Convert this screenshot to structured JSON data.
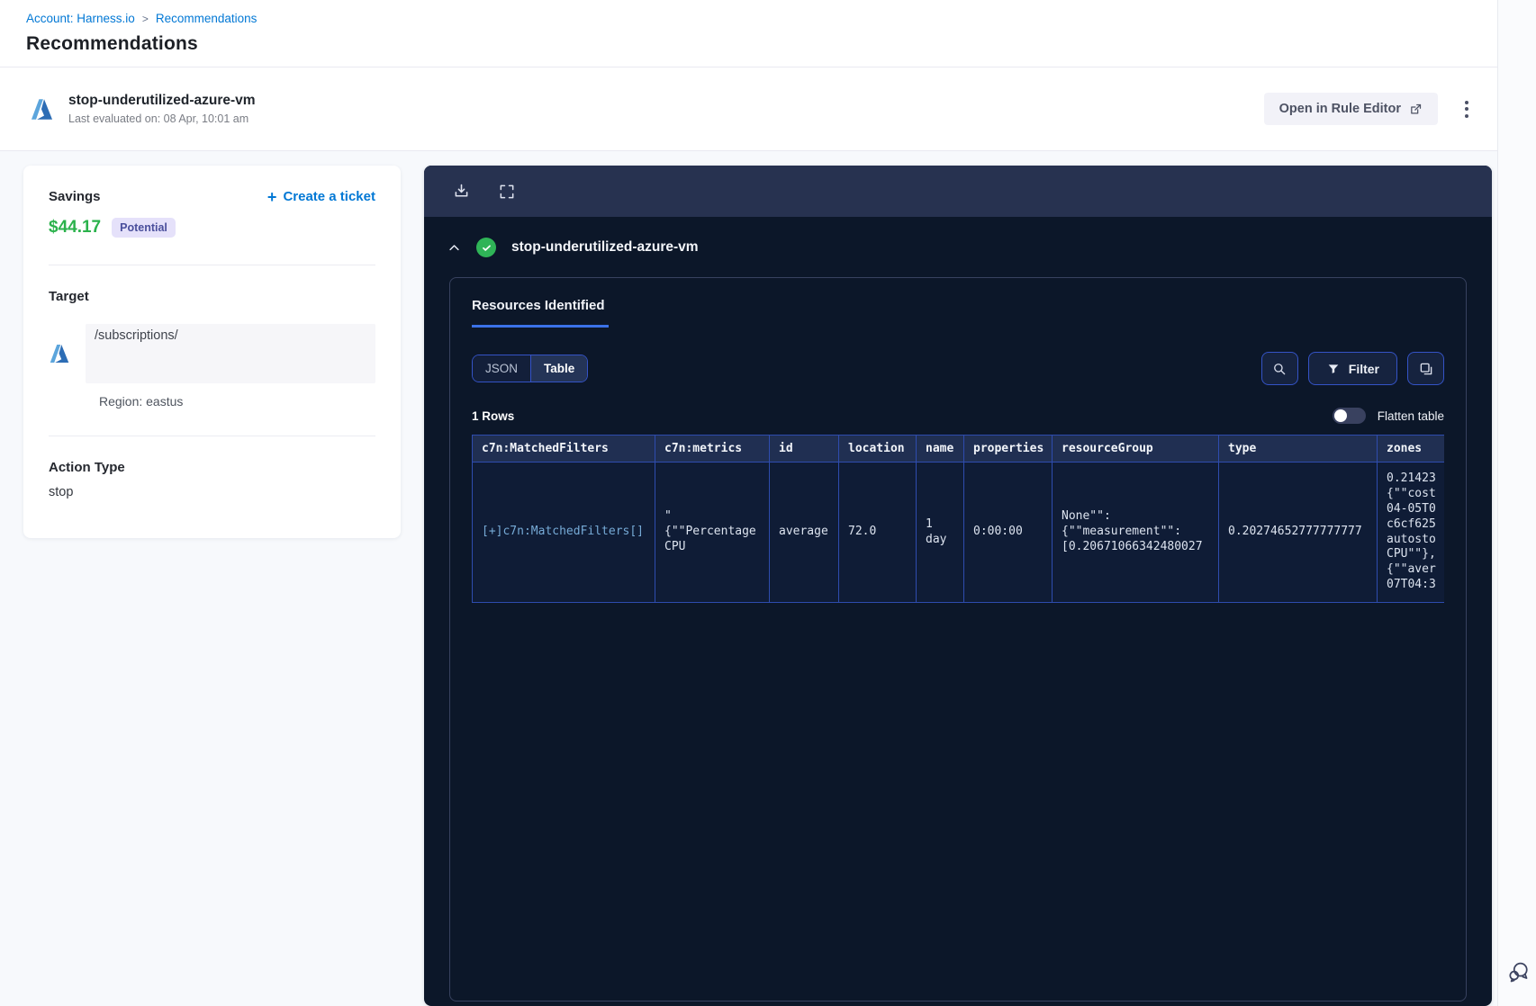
{
  "breadcrumb": {
    "account_link": "Account: Harness.io",
    "separator": ">",
    "current": "Recommendations"
  },
  "page_title": "Recommendations",
  "rec_header": {
    "title": "stop-underutilized-azure-vm",
    "last_evaluated": "Last evaluated on: 08 Apr, 10:01 am",
    "open_rule_editor": "Open in Rule Editor"
  },
  "summary_card": {
    "savings_label": "Savings",
    "savings_amount": "$44.17",
    "savings_badge": "Potential",
    "create_ticket_plus": "+",
    "create_ticket_label": "Create a ticket",
    "target_label": "Target",
    "target_path": "/subscriptions/",
    "target_region": "Region: eastus",
    "action_type_label": "Action Type",
    "action_type_value": "stop"
  },
  "viewer": {
    "resource_title": "stop-underutilized-azure-vm",
    "tab_resources": "Resources Identified",
    "toggle_json": "JSON",
    "toggle_table": "Table",
    "filter_button": "Filter",
    "rows_count": "1 Rows",
    "flatten_label": "Flatten table",
    "table": {
      "columns": [
        "c7n:MatchedFilters",
        "c7n:metrics",
        "id",
        "location",
        "name",
        "properties",
        "resourceGroup",
        "type",
        "zones"
      ],
      "row_values": [
        "[+]c7n:MatchedFilters[]",
        "\"\n{\"\"Percentage\nCPU",
        "average",
        "72.0",
        "1 day",
        "0:00:00",
        "None\"\":\n{\"\"measurement\"\":\n[0.20671066342480027",
        "0.20274652777777777",
        "0.21423\n{\"\"cost\n04-05T0\nc6cf625\nautosto\nCPU\"\"},\n{\"\"aver\n07T04:3"
      ]
    }
  },
  "colors": {
    "accent_blue": "#0278d5",
    "savings_green": "#2bb24c",
    "badge_bg": "#e5e1fa",
    "badge_text": "#4a4f9c",
    "panel_bg": "#0c1729",
    "panel_toolbar_bg": "#273250",
    "control_border": "#3453c6",
    "table_border": "#2e4cae",
    "tab_underline": "#3b72e8",
    "success_green": "#2fb457"
  }
}
